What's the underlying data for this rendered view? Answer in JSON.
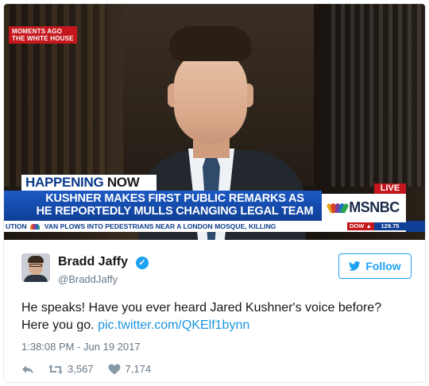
{
  "media": {
    "corner_tag": [
      "MOMENTS AGO",
      "THE WHITE HOUSE"
    ],
    "banner_label": "HAPPENING",
    "banner_label_accent": "NOW",
    "headline_line1": "KUSHNER MAKES FIRST PUBLIC REMARKS AS",
    "headline_line2": "HE REPORTEDLY MULLS CHANGING LEGAL TEAM",
    "live_label": "LIVE",
    "network": "MSNBC",
    "ticker_lead": "UTION",
    "ticker_text": "VAN PLOWS INTO PEDESTRIANS NEAR A LONDON MOSQUE, KILLING",
    "ticker_index": "DOW",
    "ticker_value": "129.75"
  },
  "tweet": {
    "author_name": "Bradd Jaffy",
    "author_handle": "@BraddJaffy",
    "follow_label": "Follow",
    "text_line1": "He speaks! Have you ever heard Jared Kushner's voice before?",
    "text_line2_prefix": "Here you go. ",
    "link_text": "pic.twitter.com/QKElf1bynn",
    "timestamp": "1:38:08 PM - Jun 19 2017",
    "retweet_count": "3,567",
    "like_count": "7,174"
  },
  "colors": {
    "accent": "#1da1f2",
    "link": "#1b95e0",
    "secondary_text": "#657786",
    "msnbc_blue": "#0f3f96",
    "msnbc_red": "#c4161c"
  },
  "icons": [
    "verified-badge-icon",
    "twitter-bird-icon",
    "reply-icon",
    "retweet-icon",
    "heart-icon"
  ]
}
